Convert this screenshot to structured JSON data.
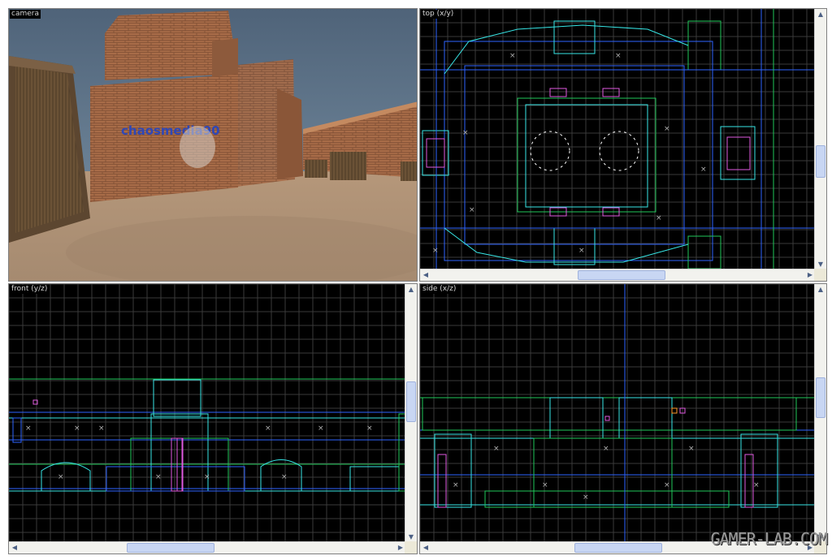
{
  "viewports": {
    "camera": {
      "label": "camera"
    },
    "top": {
      "label": "top (x/y)"
    },
    "front": {
      "label": "front (y/z)"
    },
    "side": {
      "label": "side (x/z)"
    }
  },
  "scene": {
    "wall_logo_text": "chaosmedia90"
  },
  "watermark": "GAMER-LAB.COM",
  "colors": {
    "viewport_bg": "#000000",
    "grid": "#3a3a3a",
    "grid_major": "#555555",
    "brush_blue": "#2e63ff",
    "brush_cyan": "#37e6e6",
    "brush_green": "#21c85a",
    "brush_white": "#ffffff",
    "entity_magenta": "#e05ae0",
    "scroll_thumb": "#c8d6f3"
  },
  "icons": {
    "scroll_up": "arrow-up-icon",
    "scroll_down": "arrow-down-icon",
    "scroll_left": "arrow-left-icon",
    "scroll_right": "arrow-right-icon"
  }
}
